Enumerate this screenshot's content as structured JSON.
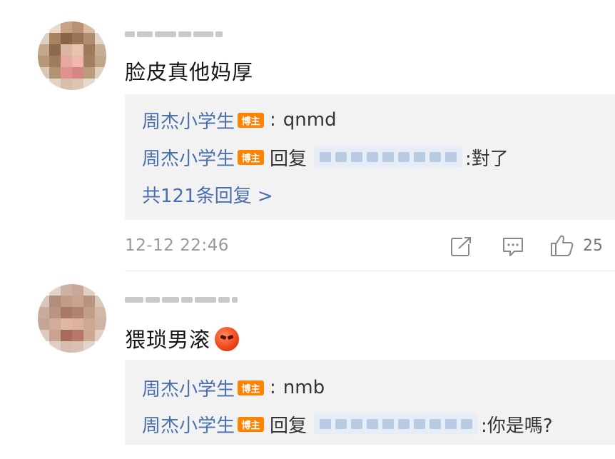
{
  "comments": [
    {
      "text": "脸皮真他妈厚",
      "has_emoji": false,
      "replies": [
        {
          "user": "周杰小学生",
          "badge": "博主",
          "type": "comment",
          "sep": ":",
          "text": "qnmd"
        },
        {
          "user": "周杰小学生",
          "badge": "博主",
          "type": "reply",
          "sep": "回复",
          "text": ":對了"
        }
      ],
      "more_replies": "共121条回复 >",
      "time": "12-12 22:46",
      "likes": "25",
      "actions": [
        "share-icon",
        "comment-icon",
        "like-icon"
      ]
    },
    {
      "text": "猥琐男滚",
      "has_emoji": true,
      "emoji": "angry-face-emoji",
      "replies": [
        {
          "user": "周杰小学生",
          "badge": "博主",
          "type": "comment",
          "sep": ":",
          "text": "nmb"
        },
        {
          "user": "周杰小学生",
          "badge": "博主",
          "type": "reply",
          "sep": "回复",
          "text": ":你是嗎?"
        }
      ]
    }
  ],
  "colors": {
    "link": "#4a6fb0",
    "badge": "#ff8200",
    "reply_bg": "#f2f2f2",
    "meta": "#9a9a9a"
  }
}
